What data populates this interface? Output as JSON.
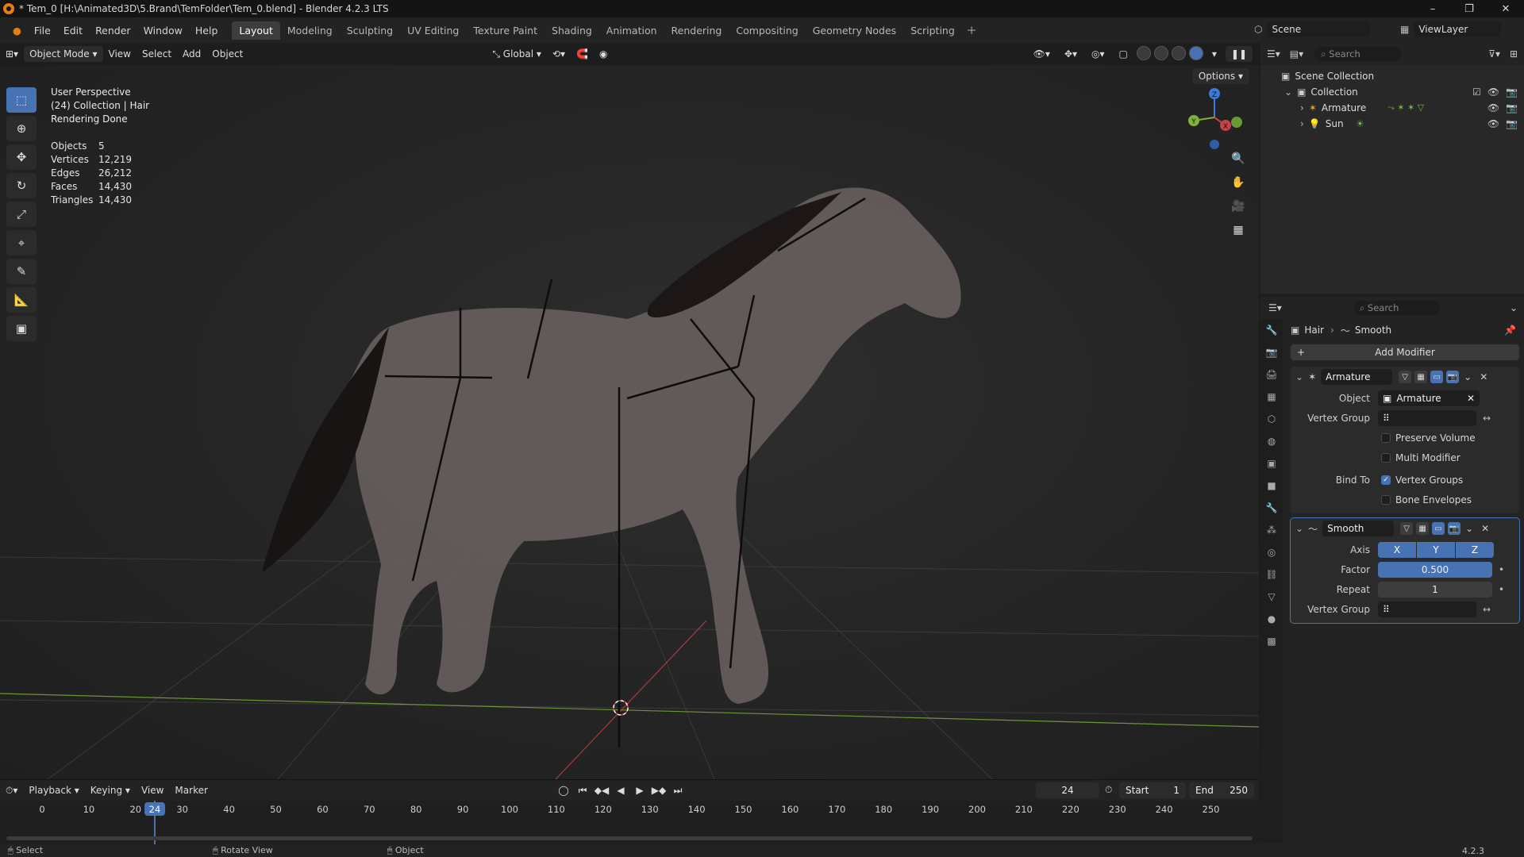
{
  "window": {
    "title": "* Tem_0 [H:\\Animated3D\\5.Brand\\TemFolder\\Tem_0.blend] - Blender 4.2.3 LTS",
    "controls": [
      "–",
      "❐",
      "✕"
    ]
  },
  "menu": [
    "File",
    "Edit",
    "Render",
    "Window",
    "Help"
  ],
  "workspaces": {
    "tabs": [
      "Layout",
      "Modeling",
      "Sculpting",
      "UV Editing",
      "Texture Paint",
      "Shading",
      "Animation",
      "Rendering",
      "Compositing",
      "Geometry Nodes",
      "Scripting"
    ],
    "active": "Layout",
    "add": "+"
  },
  "scene": {
    "name": "Scene",
    "view_layer": "ViewLayer"
  },
  "viewport_header": {
    "mode": "Object Mode",
    "menus": [
      "View",
      "Select",
      "Add",
      "Object"
    ],
    "transform_orientation": "Global",
    "options": "Options"
  },
  "viewport": {
    "info_lines": [
      "User Perspective",
      "(24) Collection | Hair",
      "Rendering Done"
    ],
    "stats": [
      {
        "label": "Objects",
        "value": "5"
      },
      {
        "label": "Vertices",
        "value": "12,219"
      },
      {
        "label": "Edges",
        "value": "26,212"
      },
      {
        "label": "Faces",
        "value": "14,430"
      },
      {
        "label": "Triangles",
        "value": "14,430"
      }
    ],
    "gizmo_axes": [
      "Z",
      "Y",
      "X"
    ],
    "colors": {
      "x_axis": "#c8424a",
      "y_axis": "#7fb23a",
      "z_axis": "#3d7bd8",
      "accent": "#4772b3"
    }
  },
  "tools": [
    "select-box",
    "cursor",
    "move",
    "rotate",
    "scale",
    "transform",
    "annotate",
    "measure",
    "add-cube"
  ],
  "timeline": {
    "menus": [
      "Playback",
      "Keying",
      "View",
      "Marker"
    ],
    "current_frame": "24",
    "start_label": "Start",
    "start": "1",
    "end_label": "End",
    "end": "250",
    "ticks": [
      "0",
      "10",
      "20",
      "30",
      "40",
      "50",
      "60",
      "70",
      "80",
      "90",
      "100",
      "110",
      "120",
      "130",
      "140",
      "150",
      "160",
      "170",
      "180",
      "190",
      "200",
      "210",
      "220",
      "230",
      "240",
      "250"
    ]
  },
  "outliner": {
    "search_placeholder": "Search",
    "root": "Scene Collection",
    "collection": "Collection",
    "items": [
      "Armature",
      "Sun"
    ]
  },
  "properties": {
    "search_placeholder": "Search",
    "breadcrumb_object": "Hair",
    "breadcrumb_modifier": "Smooth",
    "add_modifier": "Add Modifier",
    "armature_mod": {
      "name": "Armature",
      "object_label": "Object",
      "object_value": "Armature",
      "vertex_group_label": "Vertex Group",
      "preserve_volume": "Preserve Volume",
      "multi_modifier": "Multi Modifier",
      "bind_to_label": "Bind To",
      "vertex_groups": "Vertex Groups",
      "bone_envelopes": "Bone Envelopes"
    },
    "smooth_mod": {
      "name": "Smooth",
      "axis_label": "Axis",
      "axes": [
        "X",
        "Y",
        "Z"
      ],
      "factor_label": "Factor",
      "factor": "0.500",
      "repeat_label": "Repeat",
      "repeat": "1",
      "vertex_group_label": "Vertex Group"
    }
  },
  "statusbar": {
    "select": "Select",
    "rotate": "Rotate View",
    "object": "Object",
    "version": "4.2.3"
  }
}
